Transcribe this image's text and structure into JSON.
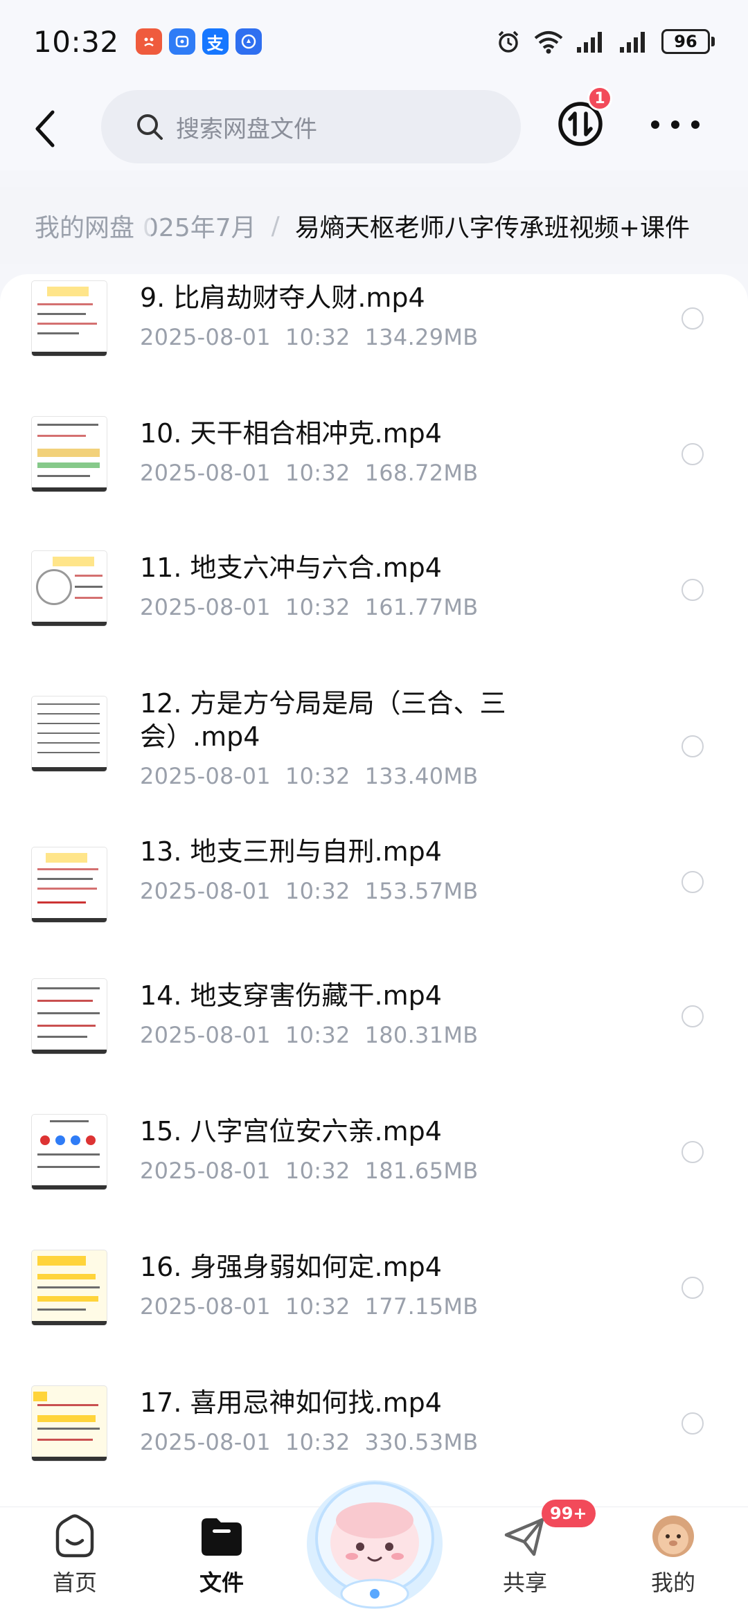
{
  "status_bar": {
    "time": "10:32",
    "apps": [
      {
        "icon": "red-app-icon",
        "color": "#ef5b3d"
      },
      {
        "icon": "blue-app-icon",
        "color": "#2f7cf6"
      },
      {
        "icon": "alipay-icon",
        "glyph": "支",
        "color": "#1677ff"
      },
      {
        "icon": "blue-hand-app-icon",
        "color": "#2f6ff0"
      }
    ],
    "battery": "96"
  },
  "top_bar": {
    "search_placeholder": "搜索网盘文件",
    "transfer_badge": "1"
  },
  "breadcrumb": {
    "root": "我的网盘",
    "middle": "025年7月",
    "separator": "/",
    "current": "易熵天枢老师八字传承班视频+课件"
  },
  "files": [
    {
      "name": "9. 比肩劫财夺人财.mp4",
      "date": "2025-08-01",
      "time": "10:32",
      "size": "134.29MB"
    },
    {
      "name": "10. 天干相合相冲克.mp4",
      "date": "2025-08-01",
      "time": "10:32",
      "size": "168.72MB"
    },
    {
      "name": "11. 地支六冲与六合.mp4",
      "date": "2025-08-01",
      "time": "10:32",
      "size": "161.77MB"
    },
    {
      "name": "12. 方是方兮局是局（三合、三会）.mp4",
      "date": "2025-08-01",
      "time": "10:32",
      "size": "133.40MB"
    },
    {
      "name": "13. 地支三刑与自刑.mp4",
      "date": "2025-08-01",
      "time": "10:32",
      "size": "153.57MB"
    },
    {
      "name": "14. 地支穿害伤藏干.mp4",
      "date": "2025-08-01",
      "time": "10:32",
      "size": "180.31MB"
    },
    {
      "name": "15. 八字宫位安六亲.mp4",
      "date": "2025-08-01",
      "time": "10:32",
      "size": "181.65MB"
    },
    {
      "name": "16. 身强身弱如何定.mp4",
      "date": "2025-08-01",
      "time": "10:32",
      "size": "177.15MB"
    },
    {
      "name": "17. 喜用忌神如何找.mp4",
      "date": "2025-08-01",
      "time": "10:32",
      "size": "330.53MB"
    }
  ],
  "bottom_nav": {
    "home": "首页",
    "files": "文件",
    "share": "共享",
    "me": "我的",
    "share_badge": "99+"
  }
}
